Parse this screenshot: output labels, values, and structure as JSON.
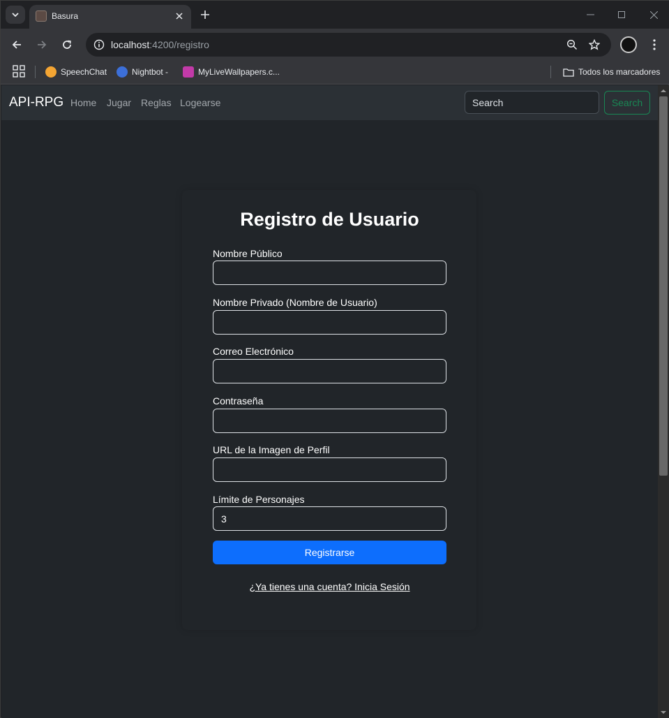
{
  "browser": {
    "tab_title": "Basura",
    "url_host": "localhost",
    "url_path": ":4200/registro",
    "bookmarks": [
      {
        "label": "SpeechChat",
        "color": "#f4a533"
      },
      {
        "label": "Nightbot -",
        "color": "#3c6fd8"
      },
      {
        "label": "MyLiveWallpapers.c...",
        "color": "#c23aa8"
      }
    ],
    "all_bookmarks_label": "Todos los marcadores"
  },
  "navbar": {
    "brand": "API-RPG",
    "links": [
      "Home",
      "Jugar",
      "Reglas",
      "Logearse"
    ],
    "search_placeholder": "Search",
    "search_button": "Search"
  },
  "form": {
    "title": "Registro de Usuario",
    "fields": [
      {
        "label": "Nombre Público",
        "value": ""
      },
      {
        "label": "Nombre Privado (Nombre de Usuario)",
        "value": ""
      },
      {
        "label": "Correo Electrónico",
        "value": ""
      },
      {
        "label": "Contraseña",
        "value": ""
      },
      {
        "label": "URL de la Imagen de Perfil",
        "value": ""
      },
      {
        "label": "Límite de Personajes",
        "value": "3"
      }
    ],
    "submit": "Registrarse",
    "login_link": "¿Ya tienes una cuenta? Inicia Sesión"
  },
  "colors": {
    "primary": "#0d6efd",
    "success": "#198754",
    "page_bg": "#212529",
    "navbar_bg": "#2b3035"
  }
}
